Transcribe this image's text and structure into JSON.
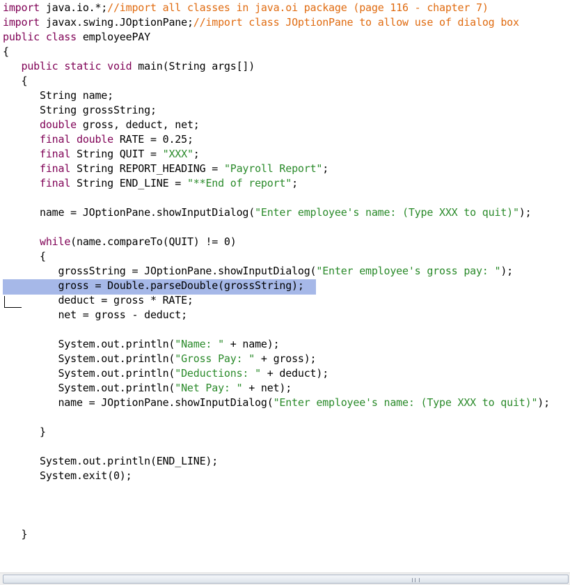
{
  "editor": {
    "lines": [
      [
        {
          "c": "kw",
          "t": "import"
        },
        {
          "c": "",
          "t": " java.io.*;"
        },
        {
          "c": "cm",
          "t": "//import all classes in java.oi package (page 116 - chapter 7)"
        }
      ],
      [
        {
          "c": "kw",
          "t": "import"
        },
        {
          "c": "",
          "t": " javax.swing.JOptionPane;"
        },
        {
          "c": "cm",
          "t": "//import class JOptionPane to allow use of dialog box"
        }
      ],
      [
        {
          "c": "kw",
          "t": "public class"
        },
        {
          "c": "",
          "t": " employeePAY"
        }
      ],
      [
        {
          "c": "",
          "t": "{"
        }
      ],
      [
        {
          "c": "",
          "t": "   "
        },
        {
          "c": "kw",
          "t": "public static void"
        },
        {
          "c": "",
          "t": " main(String args[])"
        }
      ],
      [
        {
          "c": "",
          "t": "   {"
        }
      ],
      [
        {
          "c": "",
          "t": "      String name;"
        }
      ],
      [
        {
          "c": "",
          "t": "      String grossString;"
        }
      ],
      [
        {
          "c": "",
          "t": "      "
        },
        {
          "c": "kw",
          "t": "double"
        },
        {
          "c": "",
          "t": " gross, deduct, net;"
        }
      ],
      [
        {
          "c": "",
          "t": "      "
        },
        {
          "c": "kw",
          "t": "final double"
        },
        {
          "c": "",
          "t": " RATE = 0.25;"
        }
      ],
      [
        {
          "c": "",
          "t": "      "
        },
        {
          "c": "kw",
          "t": "final"
        },
        {
          "c": "",
          "t": " String QUIT = "
        },
        {
          "c": "str",
          "t": "\"XXX\""
        },
        {
          "c": "",
          "t": ";"
        }
      ],
      [
        {
          "c": "",
          "t": "      "
        },
        {
          "c": "kw",
          "t": "final"
        },
        {
          "c": "",
          "t": " String REPORT_HEADING = "
        },
        {
          "c": "str",
          "t": "\"Payroll Report\""
        },
        {
          "c": "",
          "t": ";"
        }
      ],
      [
        {
          "c": "",
          "t": "      "
        },
        {
          "c": "kw",
          "t": "final"
        },
        {
          "c": "",
          "t": " String END_LINE = "
        },
        {
          "c": "str",
          "t": "\"**End of report\""
        },
        {
          "c": "",
          "t": ";"
        }
      ],
      [
        {
          "c": "",
          "t": ""
        }
      ],
      [
        {
          "c": "",
          "t": "      name = JOptionPane.showInputDialog("
        },
        {
          "c": "str",
          "t": "\"Enter employee's name: (Type XXX to quit)\""
        },
        {
          "c": "",
          "t": ");"
        }
      ],
      [
        {
          "c": "",
          "t": ""
        }
      ],
      [
        {
          "c": "",
          "t": "      "
        },
        {
          "c": "kw",
          "t": "while"
        },
        {
          "c": "",
          "t": "(name.compareTo(QUIT) != 0)"
        }
      ],
      [
        {
          "c": "",
          "t": "      {"
        }
      ],
      [
        {
          "c": "",
          "t": "         grossString = JOptionPane.showInputDialog("
        },
        {
          "c": "str",
          "t": "\"Enter employee's gross pay: \""
        },
        {
          "c": "",
          "t": ");"
        }
      ],
      [
        {
          "c": "",
          "t": "         gross = Double.parseDouble(grossString);"
        }
      ],
      [
        {
          "c": "",
          "t": "         deduct = gross * RATE;"
        }
      ],
      [
        {
          "c": "",
          "t": "         net = gross - deduct;"
        }
      ],
      [
        {
          "c": "",
          "t": ""
        }
      ],
      [
        {
          "c": "",
          "t": "         System.out.println("
        },
        {
          "c": "str",
          "t": "\"Name: \""
        },
        {
          "c": "",
          "t": " + name);"
        }
      ],
      [
        {
          "c": "",
          "t": "         System.out.println("
        },
        {
          "c": "str",
          "t": "\"Gross Pay: \""
        },
        {
          "c": "",
          "t": " + gross);"
        }
      ],
      [
        {
          "c": "",
          "t": "         System.out.println("
        },
        {
          "c": "str",
          "t": "\"Deductions: \""
        },
        {
          "c": "",
          "t": " + deduct);"
        }
      ],
      [
        {
          "c": "",
          "t": "         System.out.println("
        },
        {
          "c": "str",
          "t": "\"Net Pay: \""
        },
        {
          "c": "",
          "t": " + net);"
        }
      ],
      [
        {
          "c": "",
          "t": "         name = JOptionPane.showInputDialog("
        },
        {
          "c": "str",
          "t": "\"Enter employee's name: (Type XXX to quit)\""
        },
        {
          "c": "",
          "t": ");"
        }
      ],
      [
        {
          "c": "",
          "t": ""
        }
      ],
      [
        {
          "c": "",
          "t": "      }"
        }
      ],
      [
        {
          "c": "",
          "t": ""
        }
      ],
      [
        {
          "c": "",
          "t": "      System.out.println(END_LINE);"
        }
      ],
      [
        {
          "c": "",
          "t": "      System.exit(0);"
        }
      ],
      [
        {
          "c": "",
          "t": ""
        }
      ],
      [
        {
          "c": "",
          "t": ""
        }
      ],
      [
        {
          "c": "",
          "t": ""
        }
      ],
      [
        {
          "c": "",
          "t": "   }"
        }
      ]
    ],
    "selected_line": 19
  },
  "colors": {
    "keyword": "#7f0055",
    "comment": "#e06b10",
    "string": "#2a8a2a",
    "selection": "#a6b8e8"
  }
}
